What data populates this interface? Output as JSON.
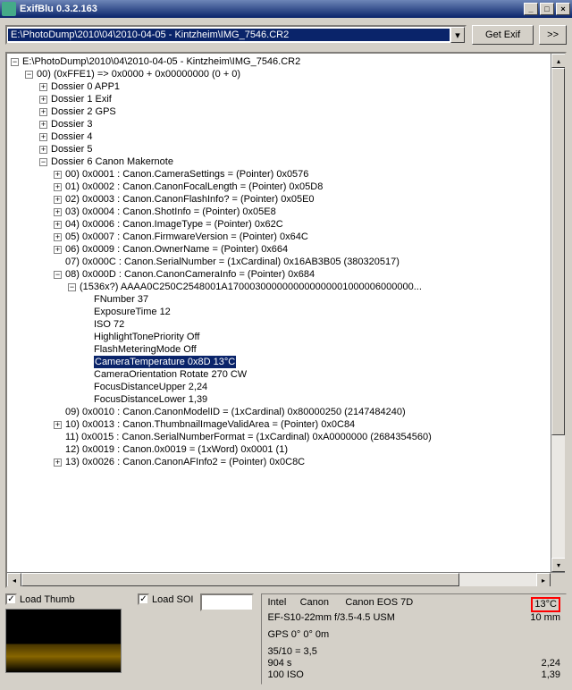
{
  "window": {
    "title": "ExifBlu 0.3.2.163"
  },
  "toolbar": {
    "path": "E:\\PhotoDump\\2010\\04\\2010-04-05 - Kintzheim\\IMG_7546.CR2",
    "getexif": "Get Exif",
    "more": ">>"
  },
  "tree": {
    "root": "E:\\PhotoDump\\2010\\04\\2010-04-05 - Kintzheim\\IMG_7546.CR2",
    "n00": "00)  (0xFFE1) => 0x0000 + 0x00000000 (0 + 0)",
    "d0": "Dossier 0 APP1",
    "d1": "Dossier 1 Exif",
    "d2": "Dossier 2 GPS",
    "d3": "Dossier 3",
    "d4": "Dossier 4",
    "d5": "Dossier 5",
    "d6": "Dossier 6 Canon Makernote",
    "m00": "00) 0x0001 : Canon.CameraSettings =  (Pointer) 0x0576",
    "m01": "01) 0x0002 : Canon.CanonFocalLength =  (Pointer) 0x05D8",
    "m02": "02) 0x0003 : Canon.CanonFlashInfo? =  (Pointer) 0x05E0",
    "m03": "03) 0x0004 : Canon.ShotInfo =  (Pointer) 0x05E8",
    "m04": "04) 0x0006 : Canon.ImageType =  (Pointer) 0x62C",
    "m05": "05) 0x0007 : Canon.FirmwareVersion =  (Pointer) 0x64C",
    "m06": "06) 0x0009 : Canon.OwnerName =  (Pointer) 0x664",
    "m07": "07) 0x000C : Canon.SerialNumber =  (1xCardinal) 0x16AB3B05 (380320517)",
    "m08": "08) 0x000D : Canon.CanonCameraInfo =  (Pointer) 0x684",
    "hex": "(1536x?) AAAA0C250C2548001A1700030000000000000001000006000000...",
    "f0": "FNumber 37",
    "f1": "ExposureTime 12",
    "f2": "ISO 72",
    "f3": "HighlightTonePriority Off",
    "f4": "FlashMeteringMode Off",
    "f5": "CameraTemperature 0x8D 13°C",
    "f6": "CameraOrientation Rotate 270 CW",
    "f7": "FocusDistanceUpper 2,24",
    "f8": "FocusDistanceLower 1,39",
    "m09": "09) 0x0010 : Canon.CanonModelID =  (1xCardinal) 0x80000250 (2147484240)",
    "m10": "10) 0x0013 : Canon.ThumbnailImageValidArea =  (Pointer) 0x0C84",
    "m11": "11) 0x0015 : Canon.SerialNumberFormat =  (1xCardinal) 0xA0000000 (2684354560)",
    "m12": "12) 0x0019 : Canon.0x0019 =  (1xWord) 0x0001 (1)",
    "m13": "13) 0x0026 : Canon.CanonAFInfo2 =  (Pointer) 0x0C8C"
  },
  "bottom": {
    "loadthumb": "Load Thumb",
    "loadsoi": "Load SOI"
  },
  "info": {
    "intel": "Intel",
    "canon": "Canon",
    "model": "Canon EOS 7D",
    "temp": "13°C",
    "lens": "EF-S10-22mm f/3.5-4.5 USM",
    "focal": "10 mm",
    "gps": "GPS 0° 0° 0m",
    "ap": "35/10 = 3,5",
    "exp": "904 s",
    "iso": "100 ISO",
    "v1": "2,24",
    "v2": "1,39"
  }
}
